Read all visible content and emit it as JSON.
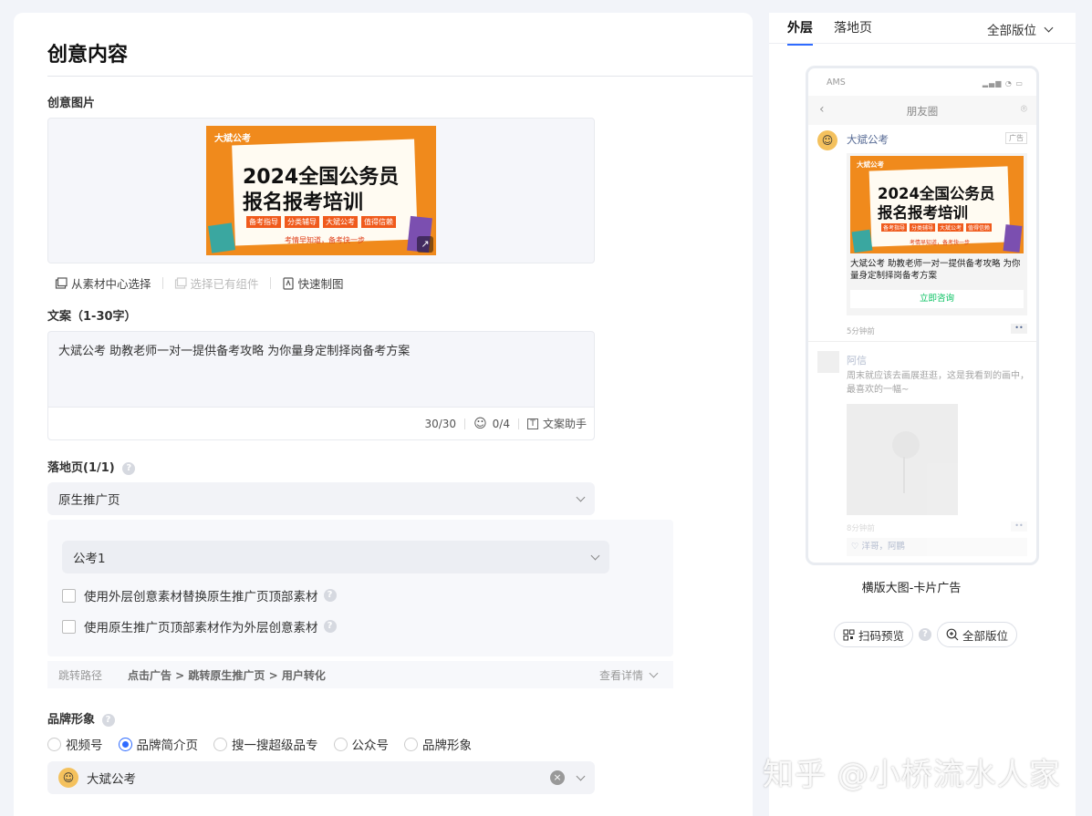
{
  "form": {
    "title": "创意内容",
    "image_label": "创意图片",
    "banner": {
      "logo": "大斌公考",
      "headline1": "2024全国公务员",
      "headline2": "报名报考培训",
      "tags": [
        "备考指导",
        "分类辅导",
        "大斌公考",
        "值得信赖"
      ],
      "slogan": "考情早知道，备考快一步"
    },
    "image_tools": {
      "from_library": "从素材中心选择",
      "select_component": "选择已有组件",
      "quick_make": "快速制图"
    },
    "copy_label": "文案（1-30字）",
    "copy_value": "大斌公考 助教老师一对一提供备考攻略 为你量身定制择岗备考方案",
    "copy_count": "30/30",
    "emoji_count": "0/4",
    "copy_helper": "文案助手",
    "landing_label": "落地页(1/1)",
    "landing_select": "原生推广页",
    "sub_select": "公考1",
    "checkbox1": "使用外层创意素材替换原生推广页顶部素材",
    "checkbox2": "使用原生推广页顶部素材作为外层创意素材",
    "path_label": "跳转路径",
    "path_value": "点击广告 > 跳转原生推广页 > 用户转化",
    "path_detail": "查看详情",
    "brand_label": "品牌形象",
    "brand_options": [
      "视频号",
      "品牌简介页",
      "搜一搜超级品专",
      "公众号",
      "品牌形象"
    ],
    "brand_selected_index": 1,
    "brand_value": "大斌公考"
  },
  "preview": {
    "tabs": [
      "外层",
      "落地页"
    ],
    "active_tab": 0,
    "position_select": "全部版位",
    "phone": {
      "carrier": "AMS",
      "nav_title": "朋友圈",
      "ad_name": "大斌公考",
      "ad_badge": "广告",
      "ad_text": "大斌公考 助教老师一对一提供备考攻略 为你量身定制择岗备考方案",
      "cta": "立即咨询",
      "ad_time": "5分钟前",
      "post_name": "阿信",
      "post_text": "周末就应该去画展逛逛，这是我看到的画中，最喜欢的一幅~",
      "post_time": "8分钟前",
      "likes": "♡ 洋哥，阿鹏"
    },
    "caption": "横版大图-卡片广告",
    "scan_button": "扫码预览",
    "all_positions_button": "全部版位"
  },
  "watermark": "知乎 @小桥流水人家",
  "colors": {
    "accent": "#2f6bff",
    "banner_orange": "#f08a1c",
    "cta_green": "#07c160"
  }
}
